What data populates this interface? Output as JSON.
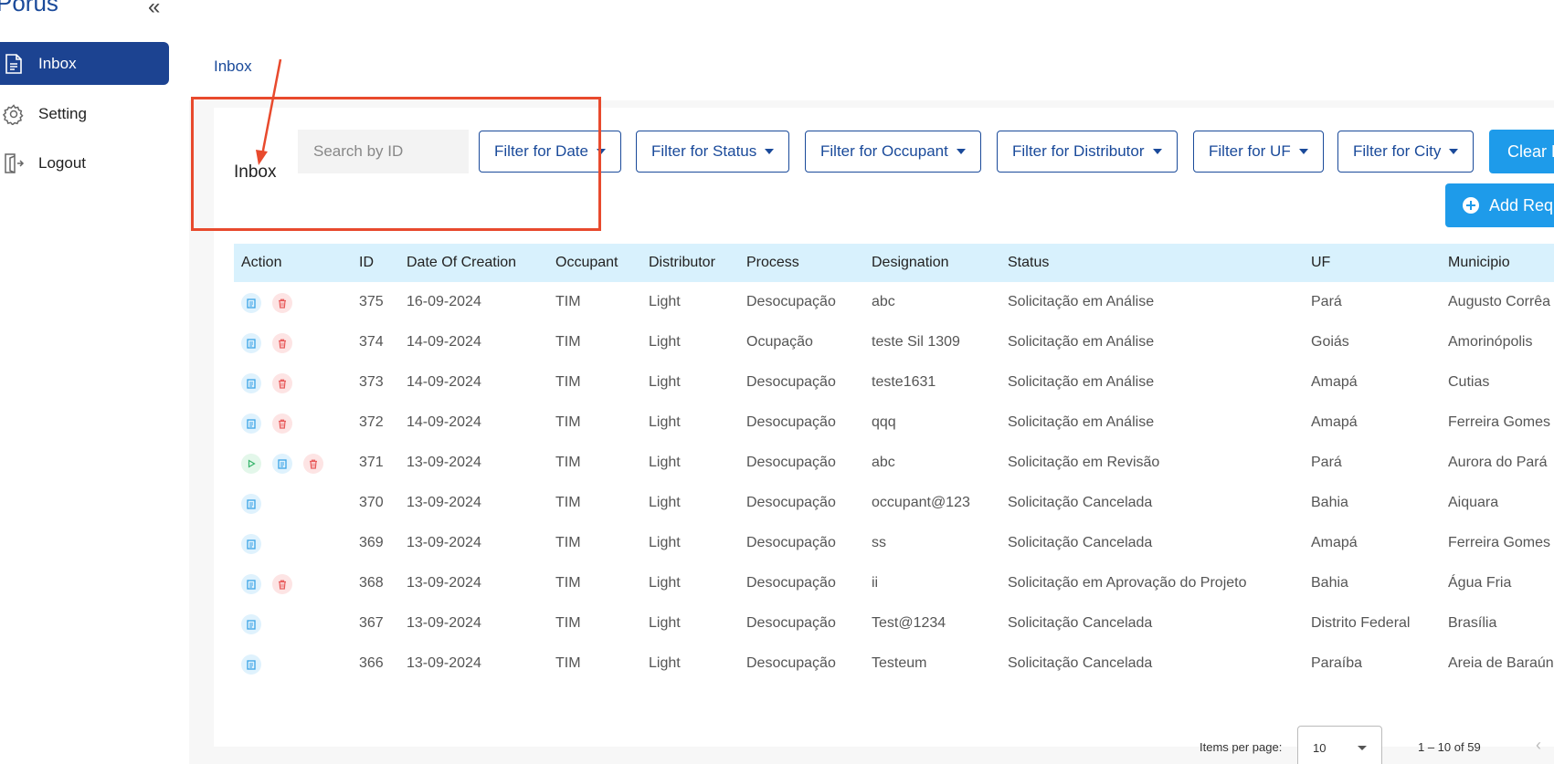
{
  "sidebar": {
    "brand": "Porus",
    "collapse_glyph": "«",
    "items": [
      {
        "label": "Inbox",
        "icon": "document-icon",
        "active": true
      },
      {
        "label": "Setting",
        "icon": "gear-icon",
        "active": false
      },
      {
        "label": "Logout",
        "icon": "logout-icon",
        "active": false
      }
    ]
  },
  "breadcrumb": "Inbox",
  "card_title": "Inbox",
  "search": {
    "placeholder": "Search by ID"
  },
  "filters": [
    "Filter for Date",
    "Filter for Status",
    "Filter for Occupant",
    "Filter for Distributor",
    "Filter for UF",
    "Filter for City"
  ],
  "clear_button": "Clear Filters",
  "add_button": "Add Request",
  "table": {
    "columns": [
      "Action",
      "ID",
      "Date Of Creation",
      "Occupant",
      "Distributor",
      "Process",
      "Designation",
      "Status",
      "UF",
      "Municipio"
    ],
    "rows": [
      {
        "actions": [
          "view",
          "delete"
        ],
        "id": "375",
        "date": "16-09-2024",
        "occupant": "TIM",
        "distributor": "Light",
        "process": "Desocupação",
        "designation": "abc",
        "status": "Solicitação em Análise",
        "uf": "Pará",
        "municipio": "Augusto Corrêa"
      },
      {
        "actions": [
          "view",
          "delete"
        ],
        "id": "374",
        "date": "14-09-2024",
        "occupant": "TIM",
        "distributor": "Light",
        "process": "Ocupação",
        "designation": "teste Sil 1309",
        "status": "Solicitação em Análise",
        "uf": "Goiás",
        "municipio": "Amorinópolis"
      },
      {
        "actions": [
          "view",
          "delete"
        ],
        "id": "373",
        "date": "14-09-2024",
        "occupant": "TIM",
        "distributor": "Light",
        "process": "Desocupação",
        "designation": "teste1631",
        "status": "Solicitação em Análise",
        "uf": "Amapá",
        "municipio": "Cutias"
      },
      {
        "actions": [
          "view",
          "delete"
        ],
        "id": "372",
        "date": "14-09-2024",
        "occupant": "TIM",
        "distributor": "Light",
        "process": "Desocupação",
        "designation": "qqq",
        "status": "Solicitação em Análise",
        "uf": "Amapá",
        "municipio": "Ferreira Gomes"
      },
      {
        "actions": [
          "play",
          "view",
          "delete"
        ],
        "id": "371",
        "date": "13-09-2024",
        "occupant": "TIM",
        "distributor": "Light",
        "process": "Desocupação",
        "designation": "abc",
        "status": "Solicitação em Revisão",
        "uf": "Pará",
        "municipio": "Aurora do Pará"
      },
      {
        "actions": [
          "view"
        ],
        "id": "370",
        "date": "13-09-2024",
        "occupant": "TIM",
        "distributor": "Light",
        "process": "Desocupação",
        "designation": "occupant@123",
        "status": "Solicitação Cancelada",
        "uf": "Bahia",
        "municipio": "Aiquara"
      },
      {
        "actions": [
          "view"
        ],
        "id": "369",
        "date": "13-09-2024",
        "occupant": "TIM",
        "distributor": "Light",
        "process": "Desocupação",
        "designation": "ss",
        "status": "Solicitação Cancelada",
        "uf": "Amapá",
        "municipio": "Ferreira Gomes"
      },
      {
        "actions": [
          "view",
          "delete"
        ],
        "id": "368",
        "date": "13-09-2024",
        "occupant": "TIM",
        "distributor": "Light",
        "process": "Desocupação",
        "designation": "ii",
        "status": "Solicitação em Aprovação do Projeto",
        "uf": "Bahia",
        "municipio": "Água Fria"
      },
      {
        "actions": [
          "view"
        ],
        "id": "367",
        "date": "13-09-2024",
        "occupant": "TIM",
        "distributor": "Light",
        "process": "Desocupação",
        "designation": "Test@1234",
        "status": "Solicitação Cancelada",
        "uf": "Distrito Federal",
        "municipio": "Brasília"
      },
      {
        "actions": [
          "view"
        ],
        "id": "366",
        "date": "13-09-2024",
        "occupant": "TIM",
        "distributor": "Light",
        "process": "Desocupação",
        "designation": "Testeum",
        "status": "Solicitação Cancelada",
        "uf": "Paraíba",
        "municipio": "Areia de Baraúnas"
      }
    ]
  },
  "paginator": {
    "label": "Items per page:",
    "page_size": "10",
    "range": "1 – 10 of 59",
    "prev_glyph": "‹"
  },
  "colors": {
    "brand": "#1a4a9a",
    "nav_active": "#1c4391",
    "primary_button": "#1e9bea",
    "table_header": "#d8f1fd",
    "annotation": "#e84a2d"
  }
}
